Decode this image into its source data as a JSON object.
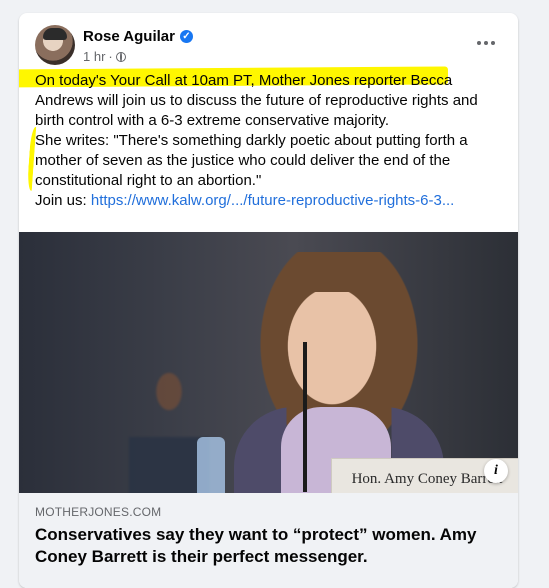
{
  "post": {
    "author": "Rose Aguilar",
    "timestamp": "1 hr",
    "separator": "·",
    "privacy_icon": "globe-icon",
    "verified_icon": "verified-check-icon",
    "more_icon": "more-options-icon",
    "paragraph1": "On today's Your Call at 10am PT, Mother Jones reporter Becca Andrews will join us to discuss the future of reproductive rights and birth control with a 6-3 extreme conservative majority.",
    "paragraph2": "She writes: \"There's something darkly poetic about putting forth a mother of seven as the justice who could deliver the end of the constitutional right to an abortion.\"",
    "paragraph3_prefix": "Join us: ",
    "paragraph3_link": "https://www.kalw.org/.../future-reproductive-rights-6-3...",
    "highlight_color": "#fff700"
  },
  "link_preview": {
    "nameplate": "Hon. Amy Coney Barrett",
    "info_label": "i",
    "domain": "MOTHERJONES.COM",
    "headline": "Conservatives say they want to “protect” women. Amy Coney Barrett is their perfect messenger."
  },
  "colors": {
    "link": "#216fdb",
    "verified": "#1877f2"
  }
}
